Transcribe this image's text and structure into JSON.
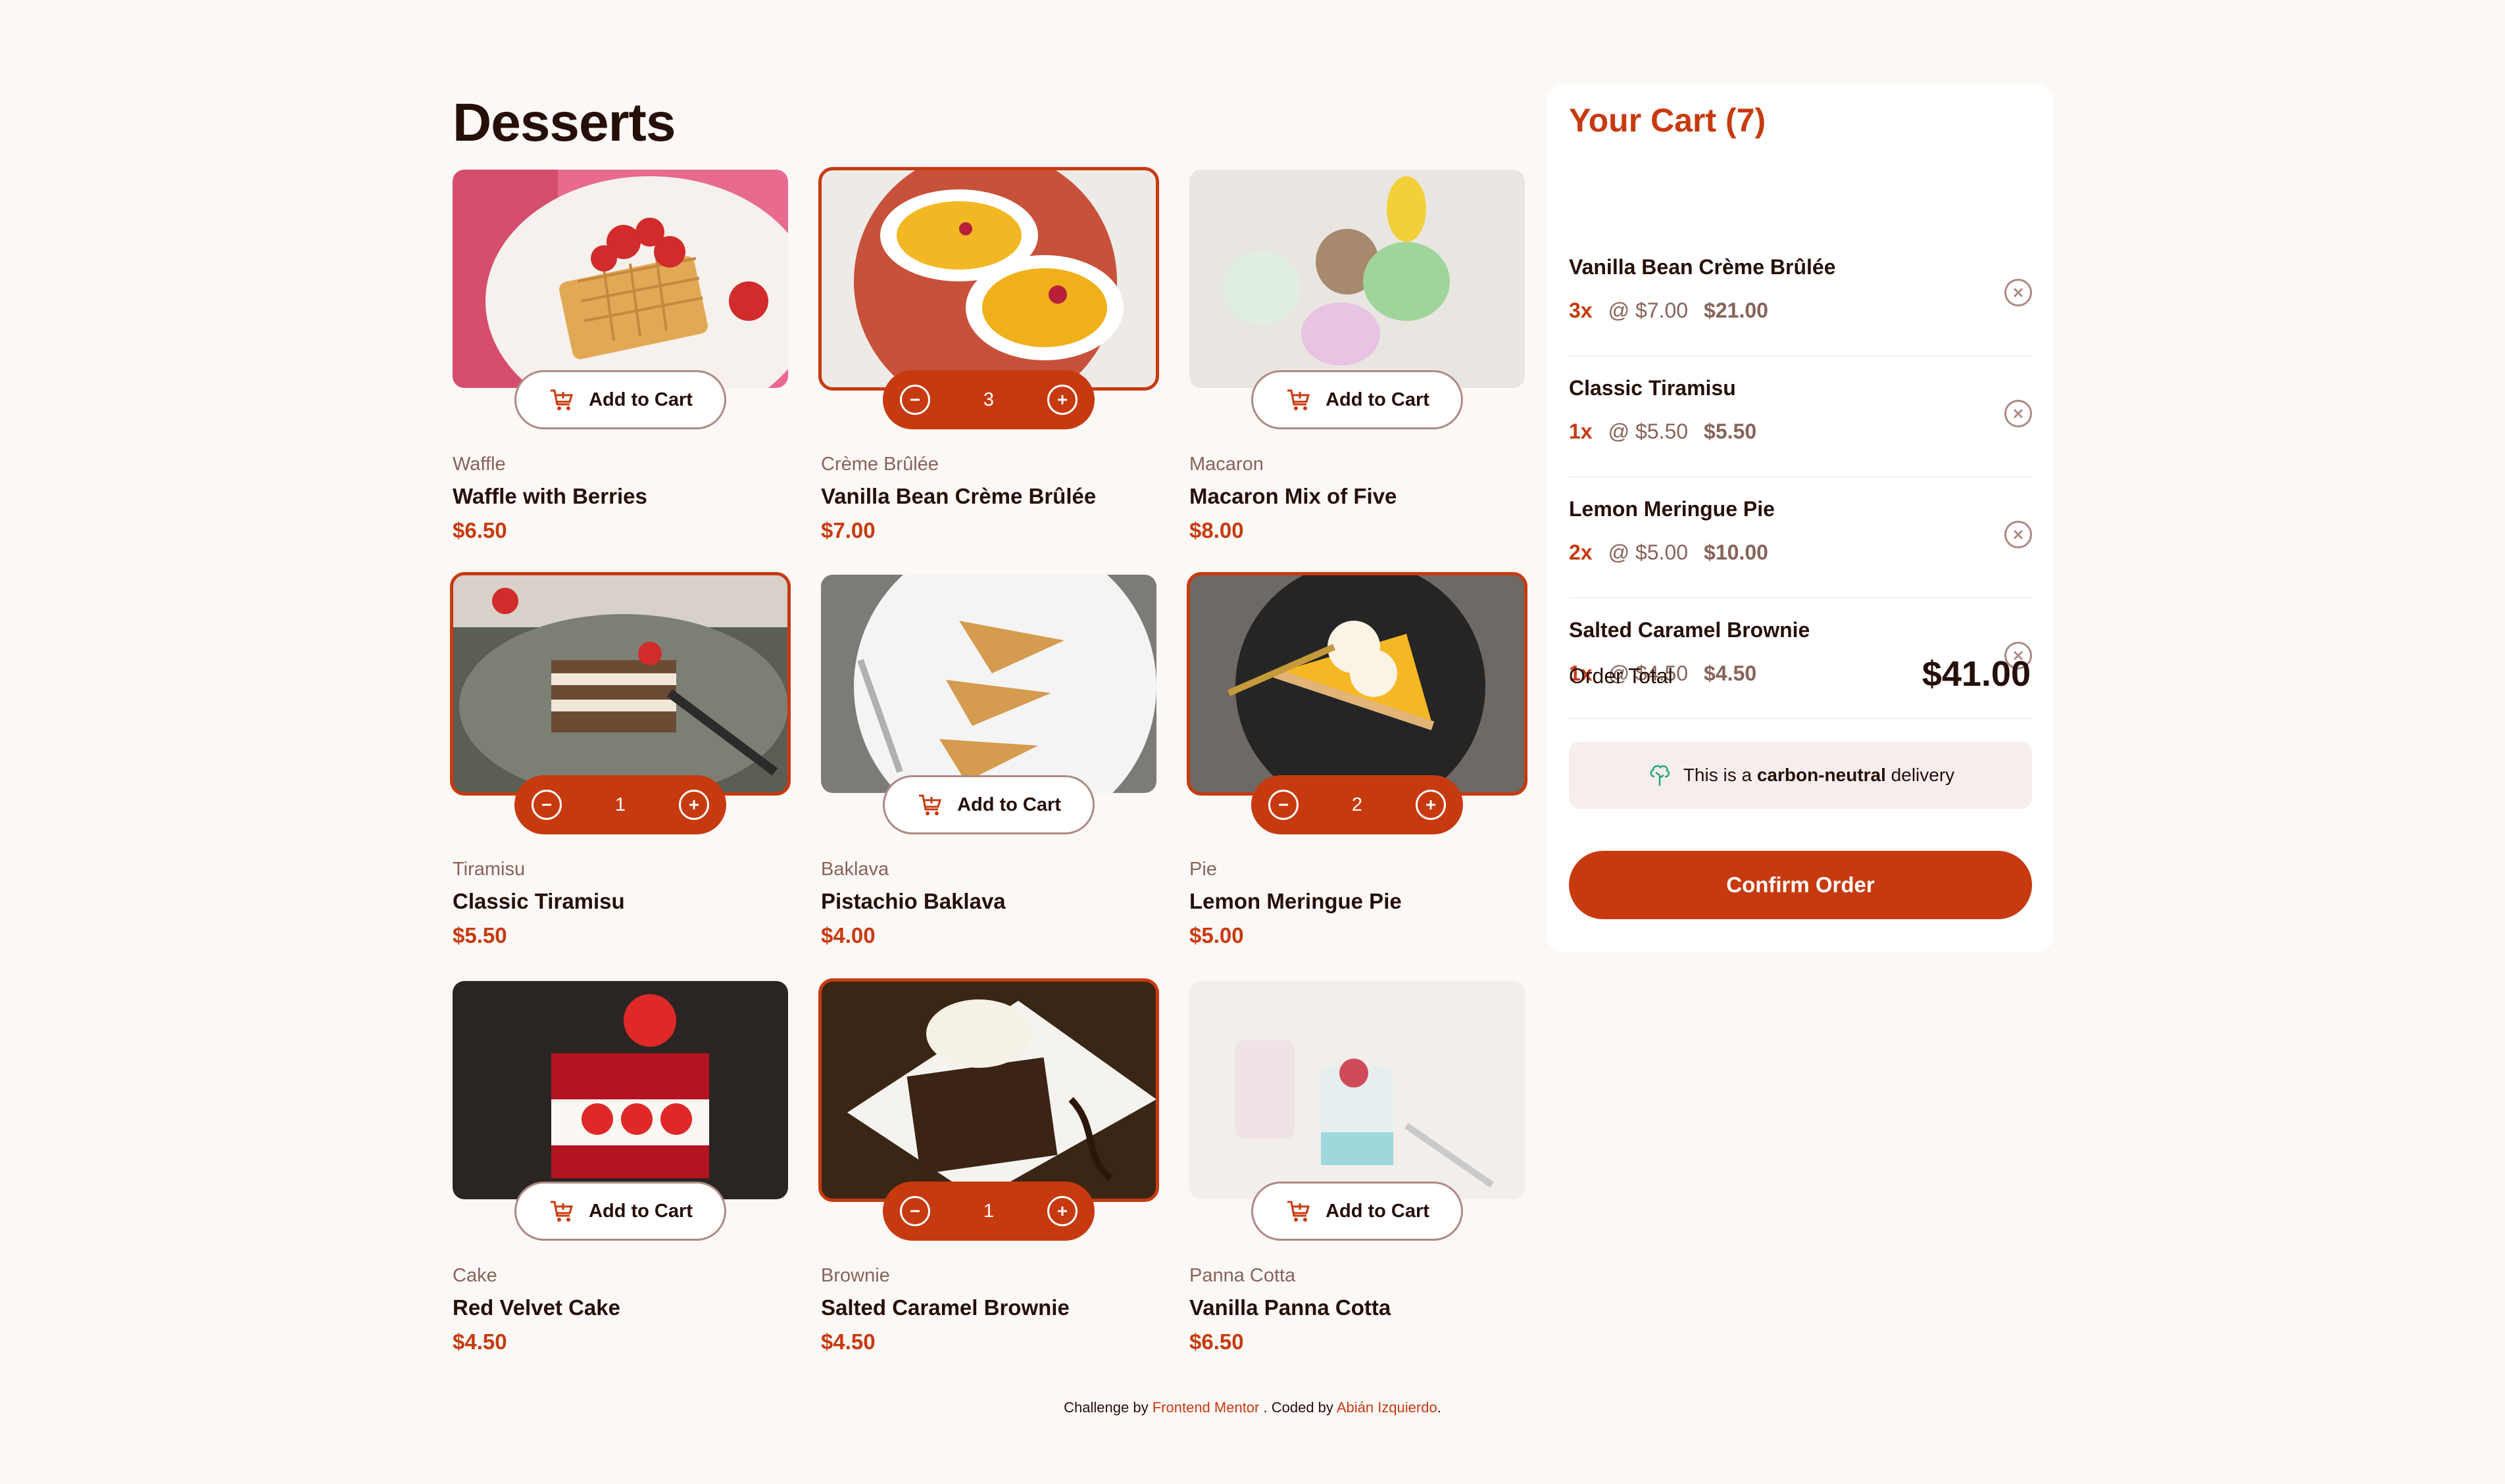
{
  "title": "Desserts",
  "add_label": "Add to Cart",
  "products": [
    {
      "category": "Waffle",
      "name": "Waffle with Berries",
      "price": "$6.50",
      "in_cart": false
    },
    {
      "category": "Crème Brûlée",
      "name": "Vanilla Bean Crème Brûlée",
      "price": "$7.00",
      "in_cart": true,
      "quantity": "3"
    },
    {
      "category": "Macaron",
      "name": "Macaron Mix of Five",
      "price": "$8.00",
      "in_cart": false
    },
    {
      "category": "Tiramisu",
      "name": "Classic Tiramisu",
      "price": "$5.50",
      "in_cart": true,
      "quantity": "1"
    },
    {
      "category": "Baklava",
      "name": "Pistachio Baklava",
      "price": "$4.00",
      "in_cart": false
    },
    {
      "category": "Pie",
      "name": "Lemon Meringue Pie",
      "price": "$5.00",
      "in_cart": true,
      "quantity": "2"
    },
    {
      "category": "Cake",
      "name": "Red Velvet Cake",
      "price": "$4.50",
      "in_cart": false
    },
    {
      "category": "Brownie",
      "name": "Salted Caramel Brownie",
      "price": "$4.50",
      "in_cart": true,
      "quantity": "1"
    },
    {
      "category": "Panna Cotta",
      "name": "Vanilla Panna Cotta",
      "price": "$6.50",
      "in_cart": false
    }
  ],
  "cart": {
    "title": "Your Cart (7)",
    "items": [
      {
        "name": "Vanilla Bean Crème Brûlée",
        "qty": "3x",
        "unit": "@ $7.00",
        "total": "$21.00"
      },
      {
        "name": "Classic Tiramisu",
        "qty": "1x",
        "unit": "@ $5.50",
        "total": "$5.50"
      },
      {
        "name": "Lemon Meringue Pie",
        "qty": "2x",
        "unit": "@ $5.00",
        "total": "$10.00"
      },
      {
        "name": "Salted Caramel Brownie",
        "qty": "1x",
        "unit": "@ $4.50",
        "total": "$4.50"
      }
    ],
    "order_total_label": "Order Total",
    "order_total": "$41.00",
    "carbon_prefix": "This is a",
    "carbon_bold": "carbon-neutral",
    "carbon_suffix": "delivery",
    "confirm_label": "Confirm Order"
  },
  "footer": {
    "prefix": "Challenge by",
    "link1": "Frontend Mentor",
    "middle": ". Coded by",
    "link2": "Abián Izquierdo",
    "suffix": "."
  },
  "colors": {
    "accent": "#c73a0f",
    "background": "#fcf8f6",
    "text_dark": "#260f08",
    "text_muted": "#87635a"
  },
  "icons": [
    "add-to-cart-icon",
    "decrement-icon",
    "increment-icon",
    "remove-item-icon",
    "carbon-neutral-icon"
  ]
}
